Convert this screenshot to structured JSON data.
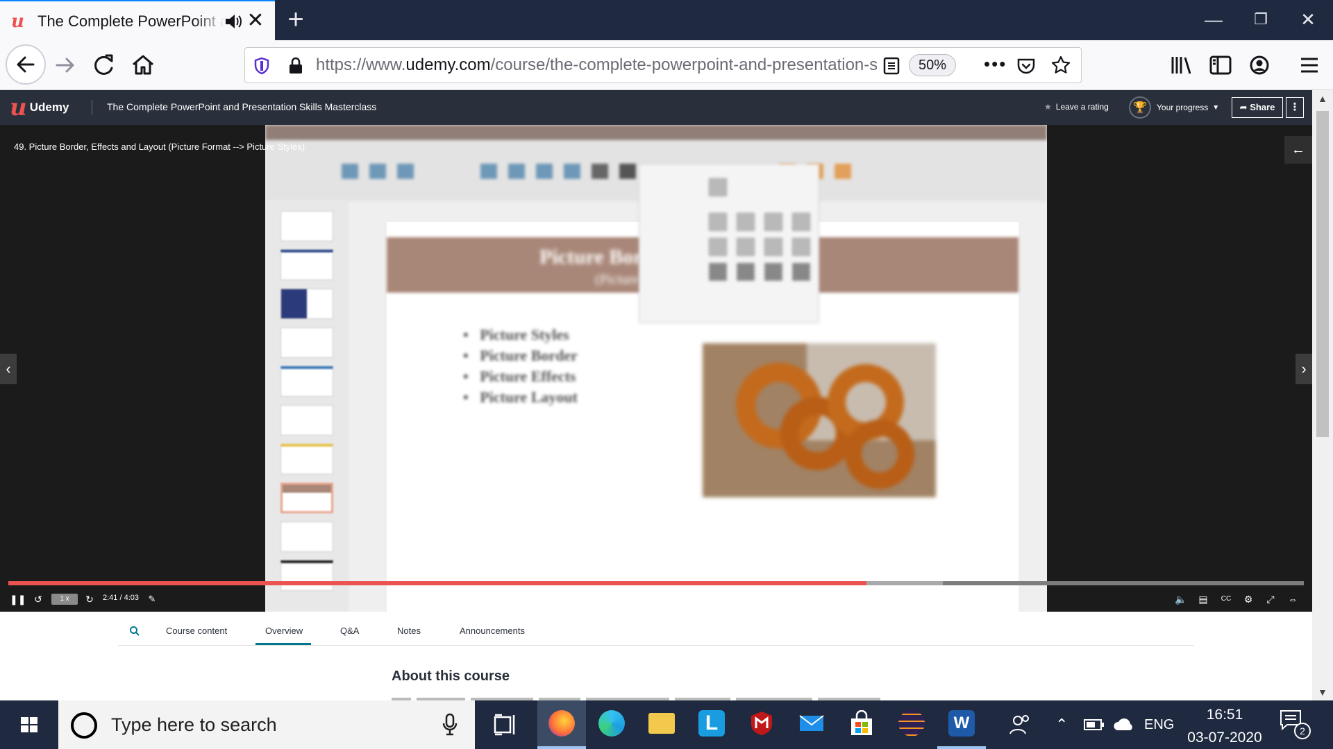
{
  "browser": {
    "tab_title": "The Complete PowerPoint and Presentation Skills Masterclass",
    "url_prefix": "https://www.",
    "url_domain": "udemy.com",
    "url_path": "/course/the-complete-powerpoint-and-presentation-skills-masterclass/",
    "zoom": "50%",
    "new_tab_symbol": "+",
    "icons": [
      "udemy-favicon",
      "speaker-icon",
      "close-icon",
      "back-icon",
      "forward-icon",
      "reload-icon",
      "home-icon",
      "shield-icon",
      "lock-icon",
      "reader-icon",
      "more-icon",
      "pocket-icon",
      "star-icon",
      "library-icon",
      "sidebar-icon",
      "account-icon",
      "menu-icon"
    ]
  },
  "udemy_header": {
    "logo_text": "Udemy",
    "course_title": "The Complete PowerPoint and Presentation Skills Masterclass",
    "leave_rating": "Leave a rating",
    "your_progress": "Your progress",
    "share": "Share"
  },
  "player": {
    "lecture_title": "49. Picture Border, Effects and Layout (Picture Format --> Picture Styles)",
    "speed": "1 x",
    "time": "2:41 / 4:03",
    "progress_fraction": 0.6623,
    "buffered_fraction": 0.7214
  },
  "slide": {
    "title": "Picture Border, Effe",
    "subtitle": "(Picture Format → P",
    "bullets": [
      "Picture Styles",
      "Picture Border",
      "Picture Effects",
      "Picture Layout"
    ]
  },
  "lower_tabs": {
    "items": [
      "Course content",
      "Overview",
      "Q&A",
      "Notes",
      "Announcements"
    ],
    "active": "Overview",
    "about_heading": "About this course"
  },
  "taskbar": {
    "search_placeholder": "Type here to search",
    "language": "ENG",
    "time": "16:51",
    "date": "03-07-2020",
    "notification_count": "2"
  },
  "colors": {
    "udemy_red": "#ec5252",
    "udemy_header": "#29303b",
    "active_tab": "#007791",
    "taskbar": "#1f2940"
  }
}
